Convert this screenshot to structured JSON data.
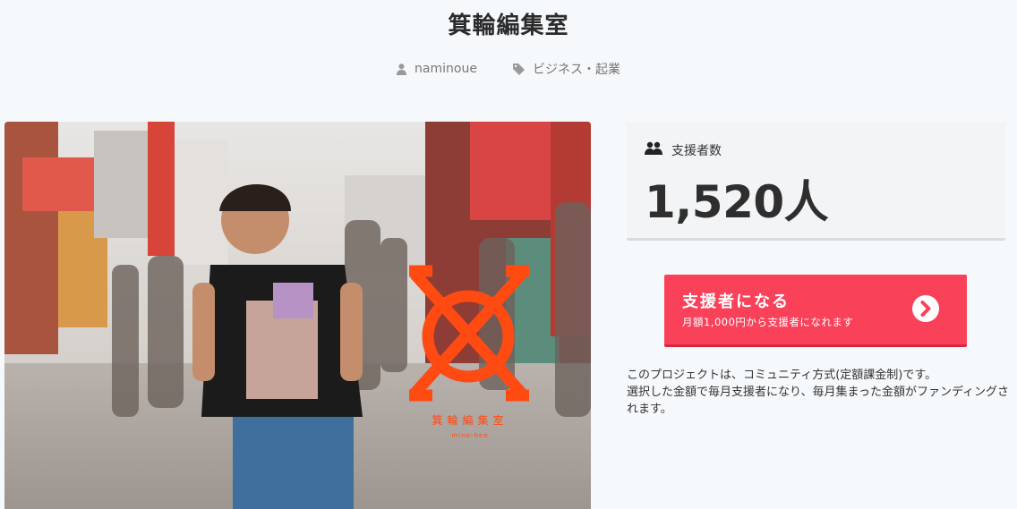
{
  "project": {
    "title": "箕輪編集室",
    "author": "naminoue",
    "category": "ビジネス・起業"
  },
  "hero": {
    "logo_text": "箕輪編集室",
    "logo_sub": "mino-hen",
    "accent_color": "#ff4a12"
  },
  "supporters": {
    "label": "支援者数",
    "count": "1,520人"
  },
  "support_button": {
    "label": "支援者になる",
    "sublabel": "月額1,000円から支援者になれます",
    "color": "#f9425a"
  },
  "description": {
    "line1": "このプロジェクトは、コミュニティ方式(定額課金制)です。",
    "line2": "選択した金額で毎月支援者になり、毎月集まった金額がファンディングされます。"
  }
}
